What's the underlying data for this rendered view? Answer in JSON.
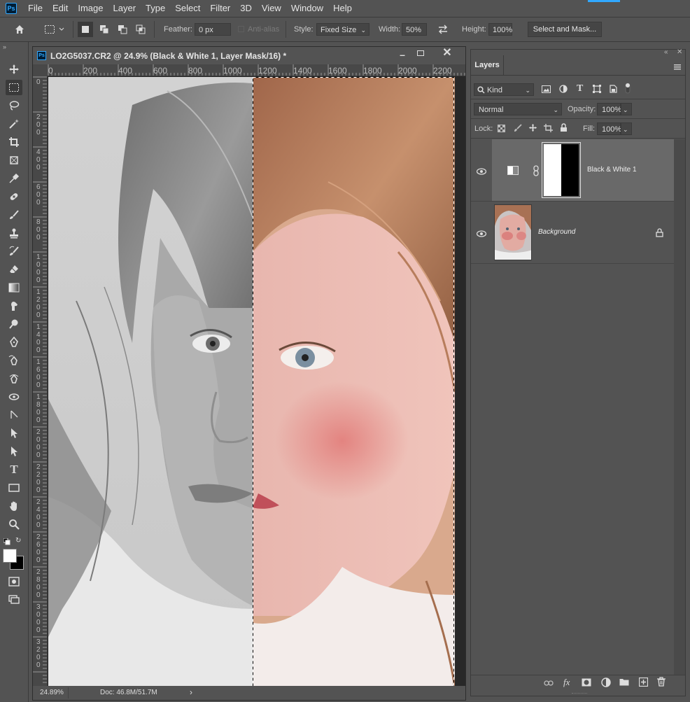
{
  "app": {
    "logo": "Ps"
  },
  "menu": [
    "File",
    "Edit",
    "Image",
    "Layer",
    "Type",
    "Select",
    "Filter",
    "3D",
    "View",
    "Window",
    "Help"
  ],
  "options": {
    "feather_label": "Feather:",
    "feather_value": "0 px",
    "antialias_label": "Anti-alias",
    "style_label": "Style:",
    "style_value": "Fixed Size",
    "width_label": "Width:",
    "width_value": "50%",
    "height_label": "Height:",
    "height_value": "100%",
    "select_mask_label": "Select and Mask..."
  },
  "document": {
    "title": "LO2G5037.CR2 @ 24.9% (Black & White 1, Layer Mask/16) *",
    "ruler_h": [
      "0",
      "200",
      "400",
      "600",
      "800",
      "1000",
      "1200",
      "1400",
      "1600",
      "1800",
      "2000",
      "2200"
    ],
    "ruler_v": [
      "0",
      "200",
      "400",
      "600",
      "800",
      "1000",
      "1200",
      "1400",
      "1600",
      "1800",
      "2000",
      "2200",
      "2400",
      "2600",
      "2800",
      "3000",
      "3200",
      "3400",
      "3600"
    ],
    "zoom": "24.89%",
    "doc_info": "Doc: 46.8M/51.7M"
  },
  "layers_panel": {
    "tab": "Layers",
    "filter_kind": "Kind",
    "blend_mode": "Normal",
    "opacity_label": "Opacity:",
    "opacity_value": "100%",
    "lock_label": "Lock:",
    "fill_label": "Fill:",
    "fill_value": "100%",
    "layers": [
      {
        "name": "Black & White 1",
        "visible": true,
        "selected": true
      },
      {
        "name": "Background",
        "visible": true,
        "locked": true
      }
    ]
  },
  "colors": {
    "foreground": "#ffffff",
    "background": "#000000",
    "accent": "#31a8ff"
  }
}
